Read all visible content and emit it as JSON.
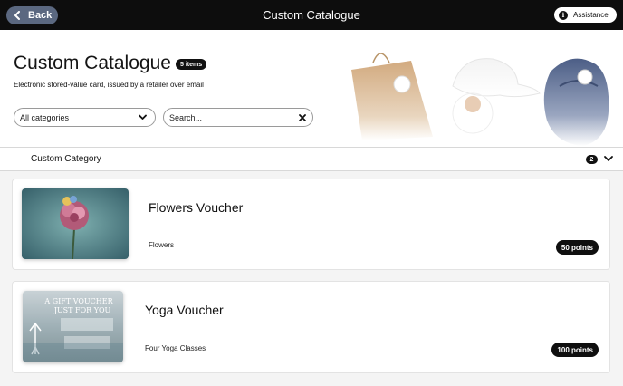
{
  "topbar": {
    "back_label": "Back",
    "title": "Custom Catalogue",
    "assistance_label": "Assistance"
  },
  "hero": {
    "title": "Custom Catalogue",
    "items_badge": "5 items",
    "subtitle": "Electronic stored-value card, issued by a retailer over email",
    "category_select": "All categories",
    "search_placeholder": "Search..."
  },
  "category": {
    "name": "Custom Category",
    "count": "2"
  },
  "vouchers": [
    {
      "name": "Flowers Voucher",
      "description": "Flowers",
      "points": "50 points"
    },
    {
      "name": "Yoga Voucher",
      "description": "Four Yoga Classes",
      "points": "100 points"
    }
  ],
  "yoga_thumb_text": {
    "line1": "A GIFT VOUCHER",
    "line2": "JUST FOR YOU"
  },
  "colors": {
    "topbar": "#0d0d0d",
    "back_button": "#5b6880",
    "badge": "#111111",
    "list_background": "#f4f4f4"
  }
}
